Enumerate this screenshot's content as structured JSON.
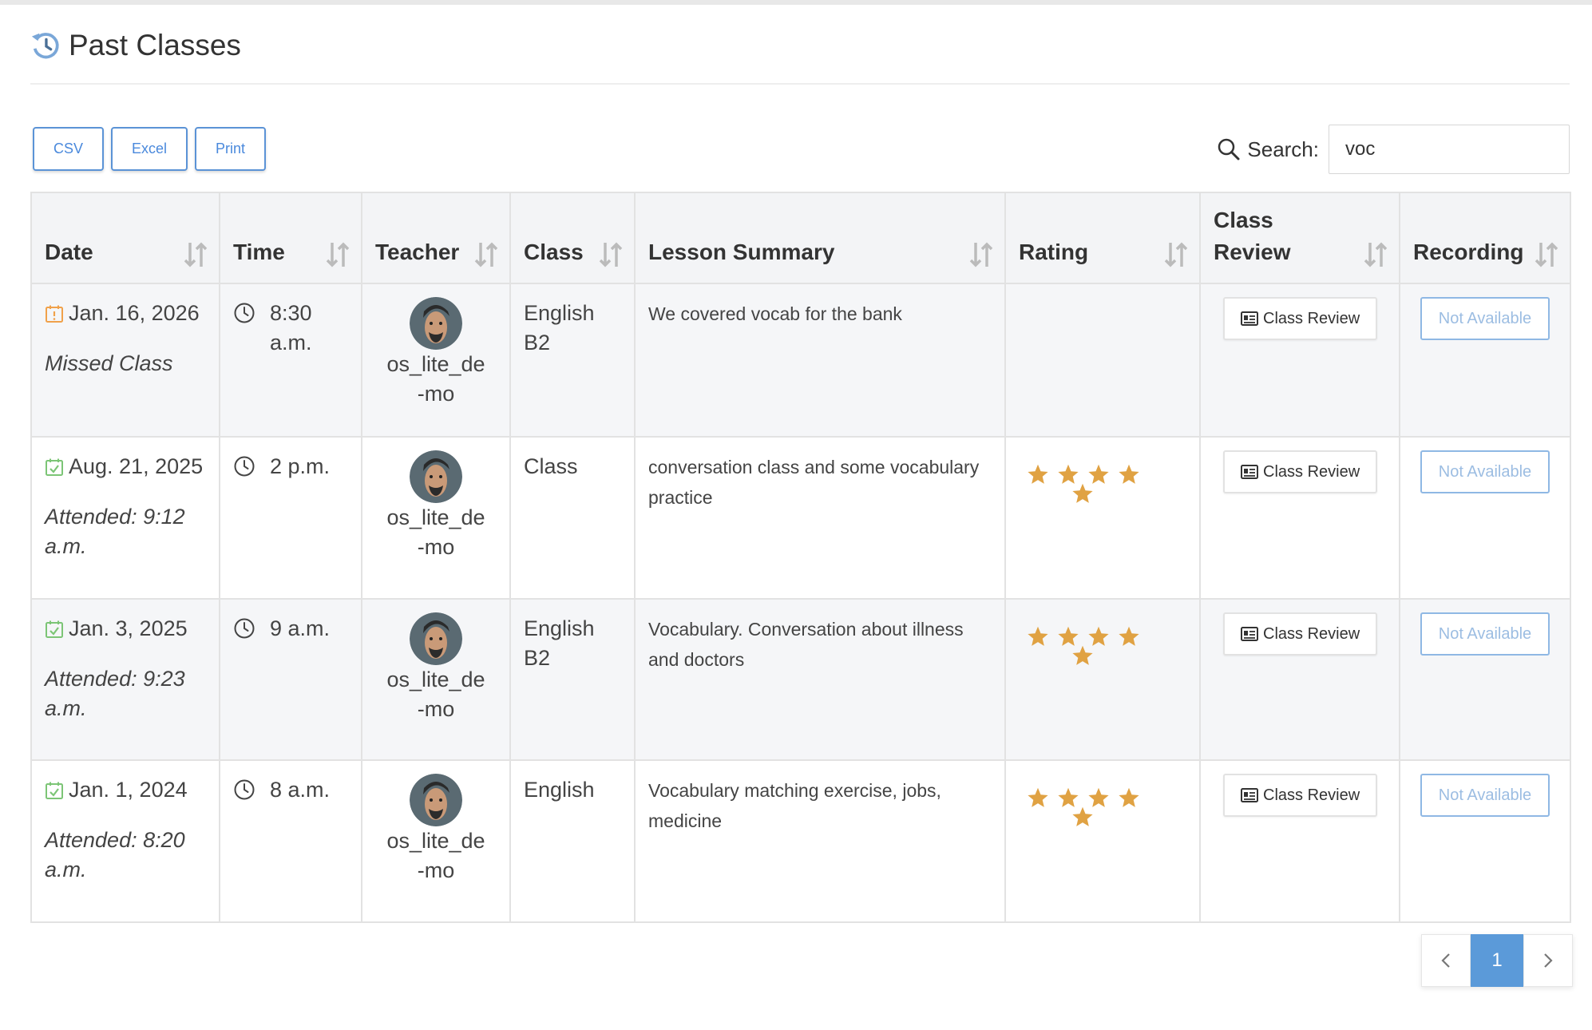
{
  "page": {
    "title": "Past Classes"
  },
  "toolbar": {
    "csv_label": "CSV",
    "excel_label": "Excel",
    "print_label": "Print",
    "search_label": "Search:",
    "search_value": "voc"
  },
  "table": {
    "headers": {
      "date": "Date",
      "time": "Time",
      "teacher": "Teacher",
      "class": "Class",
      "summary": "Lesson Summary",
      "rating": "Rating",
      "review": "Class Review",
      "recording": "Recording"
    },
    "rows": [
      {
        "date": "Jan. 16, 2026",
        "status": "Missed Class",
        "time": "8:30 a.m.",
        "teacher": "os_lite_de-mo",
        "class": "English B2",
        "summary": "We covered vocab for the bank",
        "rating": 0,
        "review_label": "Class Review",
        "recording_label": "Not Available",
        "date_icon": "calendar-missed-icon"
      },
      {
        "date": "Aug. 21, 2025",
        "status": "Attended: 9:12 a.m.",
        "time": "2 p.m.",
        "teacher": "os_lite_de-mo",
        "class": "Class",
        "summary": "conversation class and some vocabulary practice",
        "rating": 5,
        "review_label": "Class Review",
        "recording_label": "Not Available",
        "date_icon": "calendar-check-icon"
      },
      {
        "date": "Jan. 3, 2025",
        "status": "Attended: 9:23 a.m.",
        "time": "9 a.m.",
        "teacher": "os_lite_de-mo",
        "class": "English B2",
        "summary": "Vocabulary. Conversation about illness and doctors",
        "rating": 5,
        "review_label": "Class Review",
        "recording_label": "Not Available",
        "date_icon": "calendar-check-icon"
      },
      {
        "date": "Jan. 1, 2024",
        "status": "Attended: 8:20 a.m.",
        "time": "8 a.m.",
        "teacher": "os_lite_de-mo",
        "class": "English",
        "summary": "Vocabulary matching exercise, jobs, medicine",
        "rating": 5,
        "review_label": "Class Review",
        "recording_label": "Not Available",
        "date_icon": "calendar-check-icon"
      }
    ]
  },
  "pagination": {
    "current_page": "1"
  },
  "colors": {
    "accent": "#4a89dc",
    "star": "#e0a243",
    "missed": "#f0a14a",
    "attended": "#7cc576"
  }
}
